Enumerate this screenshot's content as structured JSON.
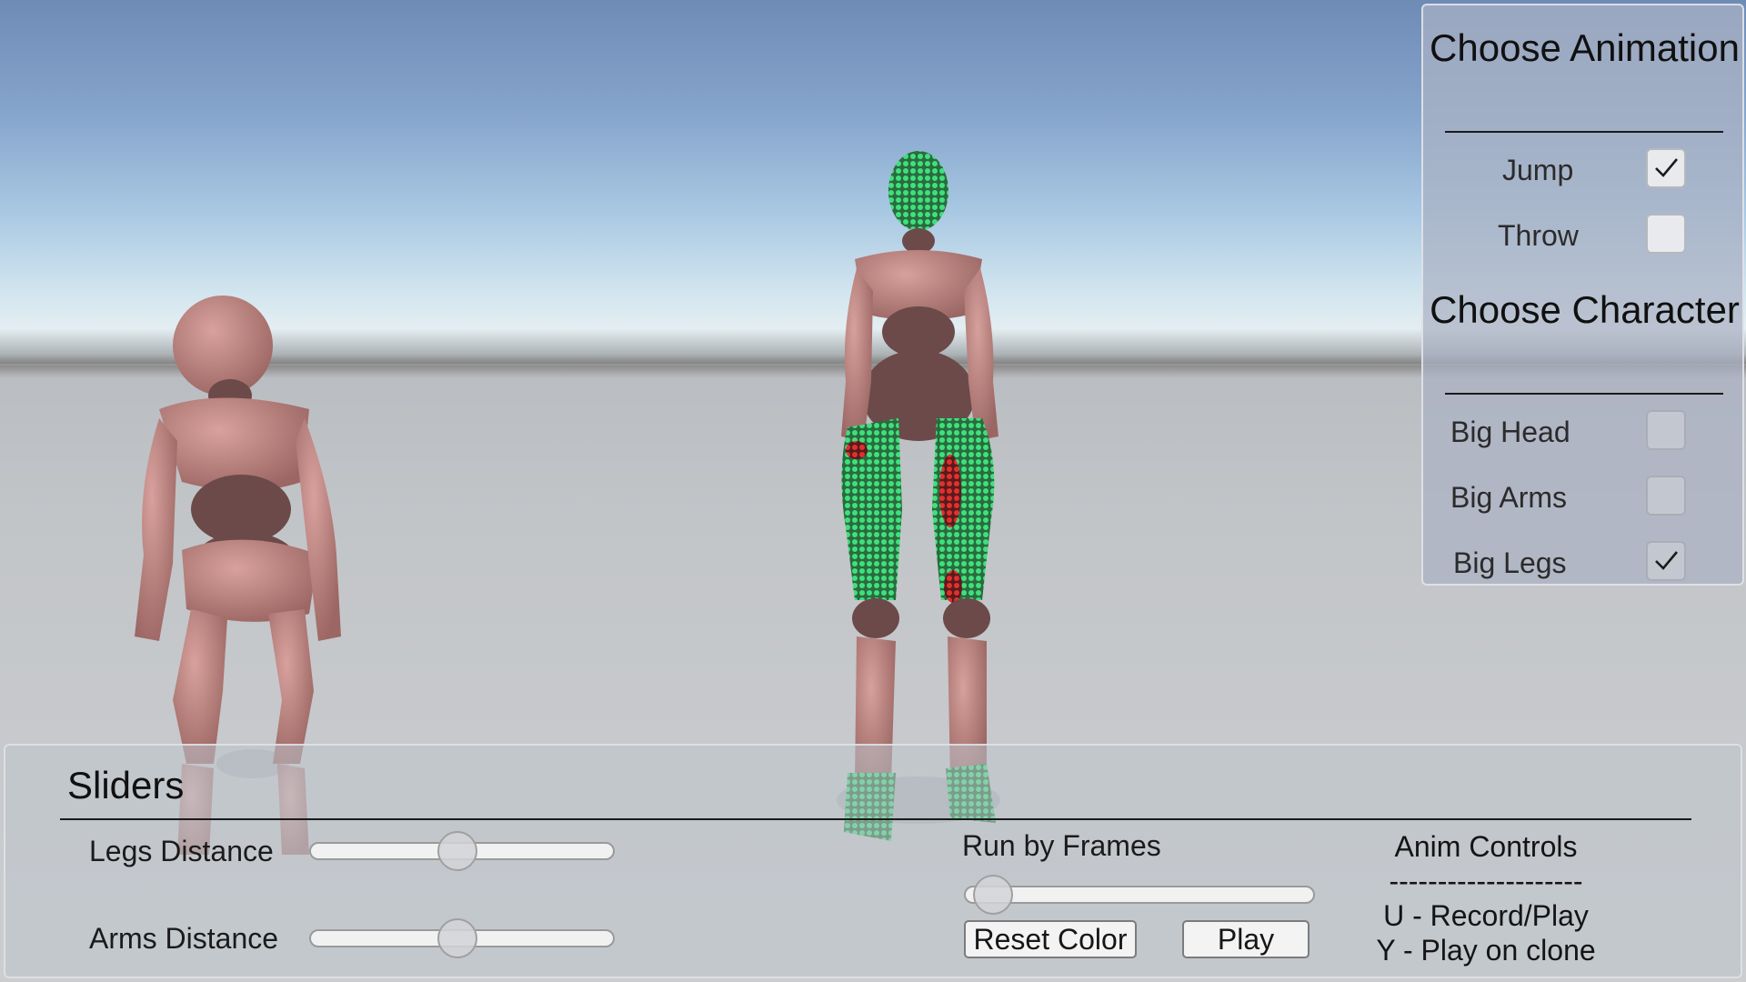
{
  "right_panel": {
    "animation_heading": "Choose Animation",
    "animation_options": [
      {
        "label": "Jump",
        "checked": true
      },
      {
        "label": "Throw",
        "checked": false
      }
    ],
    "character_heading": "Choose Character",
    "character_options": [
      {
        "label": "Big Head",
        "checked": false
      },
      {
        "label": "Big Arms",
        "checked": false
      },
      {
        "label": "Big Legs",
        "checked": true
      }
    ]
  },
  "bottom_panel": {
    "title": "Sliders",
    "legs_distance": {
      "label": "Legs Distance",
      "value": 0.49
    },
    "arms_distance": {
      "label": "Arms Distance",
      "value": 0.49
    },
    "run_by_frames": {
      "label": "Run by Frames",
      "value": 0.03
    },
    "reset_color_label": "Reset Color",
    "play_label": "Play",
    "anim_controls": {
      "title": "Anim Controls",
      "separator": "--------------------",
      "line1": "U - Record/Play",
      "line2": "Y - Play on clone"
    }
  },
  "colors": {
    "figure_skin": "#c9908c",
    "figure_shadow": "#6b4a49",
    "point_green": "#2fcf6a",
    "point_red": "#d42a2a"
  }
}
